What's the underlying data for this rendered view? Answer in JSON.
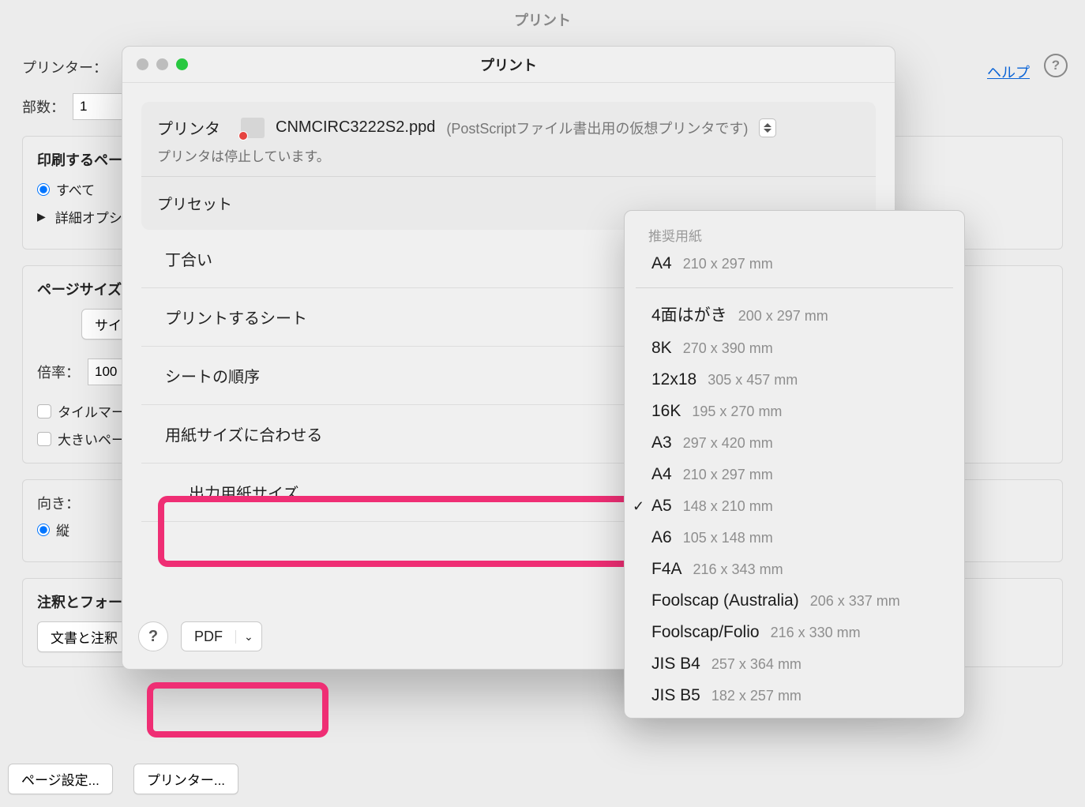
{
  "main_title": "プリント",
  "help_link": "ヘルプ",
  "back": {
    "printer_label": "プリンター：",
    "copies_label": "部数：",
    "copies_value": "1",
    "section_pages_title": "印刷するページ",
    "radio_all": "すべて",
    "detail_options": "詳細オプシ",
    "section_pagesize_title": "ページサイズ処",
    "size_button": "サイズ",
    "scale_label": "倍率：",
    "scale_value": "100",
    "tile_marks": "タイルマー",
    "large_page": "大きいペー",
    "orientation_label": "向き：",
    "orientation_portrait": "縦",
    "annot_forms_title": "注釈とフォーム",
    "annot_button": "文書と注釈",
    "page_setup_button": "ページ設定...",
    "printer_button": "プリンター..."
  },
  "fg": {
    "title": "プリント",
    "printer_label": "プリンタ",
    "printer_name": "CNMCIRC3222S2.ppd",
    "printer_desc": "(PostScriptファイル書出用の仮想プリンタです)",
    "printer_status": "プリンタは停止しています。",
    "preset_label": "プリセット",
    "rows": {
      "collate": "丁合い",
      "sheets": "プリントするシート",
      "order": "シートの順序",
      "fit_paper": "用紙サイズに合わせる",
      "output_size": "出力用紙サイズ"
    },
    "pdf_button": "PDF"
  },
  "paper_menu": {
    "heading": "推奨用紙",
    "items_top": [
      {
        "name": "A4",
        "dim": "210 x 297 mm"
      }
    ],
    "items": [
      {
        "name": "4面はがき",
        "dim": "200 x 297 mm"
      },
      {
        "name": "8K",
        "dim": "270 x 390 mm"
      },
      {
        "name": "12x18",
        "dim": "305 x 457 mm"
      },
      {
        "name": "16K",
        "dim": "195 x 270 mm"
      },
      {
        "name": "A3",
        "dim": "297 x 420 mm"
      },
      {
        "name": "A4",
        "dim": "210 x 297 mm"
      },
      {
        "name": "A5",
        "dim": "148 x 210 mm",
        "selected": true
      },
      {
        "name": "A6",
        "dim": "105 x 148 mm"
      },
      {
        "name": "F4A",
        "dim": "216 x 343 mm"
      },
      {
        "name": "Foolscap (Australia)",
        "dim": "206 x 337 mm"
      },
      {
        "name": "Foolscap/Folio",
        "dim": "216 x 330 mm"
      },
      {
        "name": "JIS B4",
        "dim": "257 x 364 mm"
      },
      {
        "name": "JIS B5",
        "dim": "182 x 257 mm"
      }
    ]
  }
}
